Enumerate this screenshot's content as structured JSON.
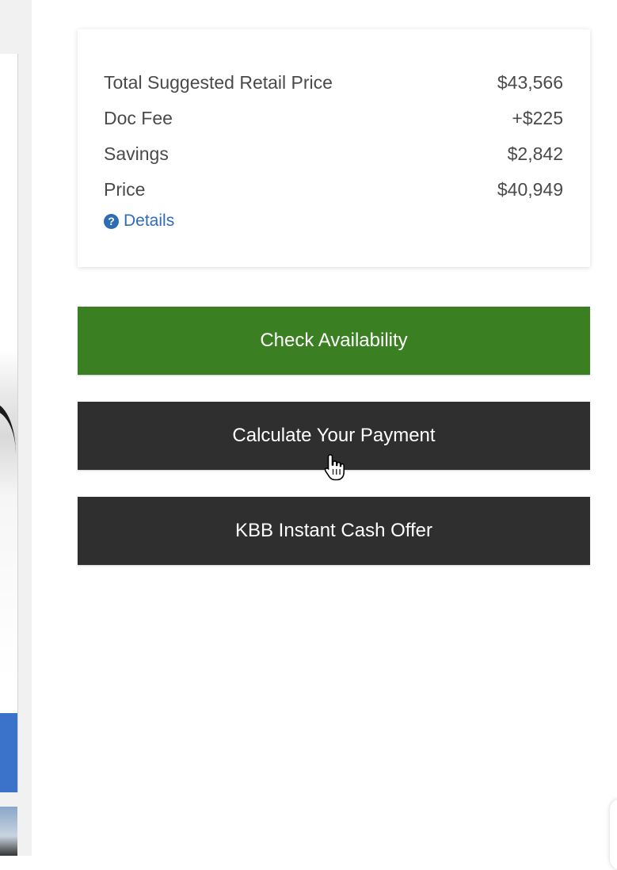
{
  "price_summary": {
    "rows": [
      {
        "label": "Total Suggested Retail Price",
        "value": "$43,566"
      },
      {
        "label": "Doc Fee",
        "value": "+$225"
      },
      {
        "label": "Savings",
        "value": "$2,842"
      },
      {
        "label": "Price",
        "value": "$40,949"
      }
    ],
    "details_label": "Details",
    "details_icon": "question-circle-icon"
  },
  "actions": {
    "check_availability": "Check Availability",
    "calculate_payment": "Calculate Your Payment",
    "kbb_offer": "KBB Instant Cash Offer"
  },
  "colors": {
    "check_availability_bg": "#3a8023",
    "dark_button_bg": "#2f2f2f",
    "link": "#2f6cb6",
    "text": "#4a4a4a"
  }
}
